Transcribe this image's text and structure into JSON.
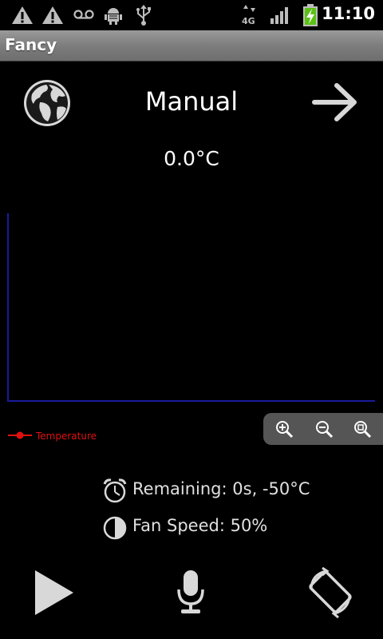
{
  "status_bar": {
    "time": "11:10",
    "icons": [
      "warning-icon",
      "warning-icon",
      "voicemail-icon",
      "android-debug-icon",
      "usb-icon",
      "4g-data-icon",
      "signal-icon",
      "battery-charging-icon"
    ]
  },
  "app": {
    "title": "Fancy"
  },
  "header": {
    "mode": "Manual",
    "temperature": "0.0°C"
  },
  "chart_data": {
    "type": "line",
    "series": [
      {
        "name": "Temperature",
        "values": []
      }
    ],
    "legend": "bottom-left",
    "colors": {
      "axis": "#1a1a9c",
      "series": "#e01010"
    }
  },
  "zoom": {
    "buttons": [
      "zoom-in-icon",
      "zoom-out-icon",
      "zoom-fit-icon"
    ]
  },
  "info": {
    "remaining": "Remaining: 0s, -50°C",
    "fan_speed": "Fan Speed: 50%"
  },
  "controls": {
    "buttons": [
      "play-icon",
      "microphone-icon",
      "rotate-icon"
    ]
  }
}
